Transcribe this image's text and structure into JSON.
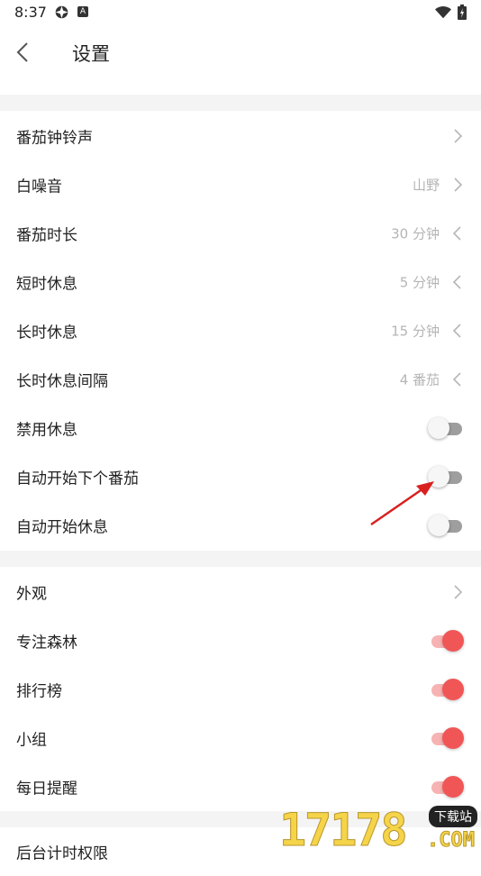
{
  "status": {
    "time": "8:37",
    "icon1": "satellite-icon",
    "icon2": "a-icon",
    "icon3": "wifi-icon",
    "icon4": "battery-icon",
    "badge": "A"
  },
  "header": {
    "title": "设置",
    "back_icon": "chevron-left-icon"
  },
  "settings": [
    {
      "label": "番茄钟铃声",
      "value": ""
    },
    {
      "label": "白噪音",
      "value": "山野"
    },
    {
      "label": "番茄时长",
      "value": "30 分钟"
    },
    {
      "label": "短时休息",
      "value": "5 分钟"
    },
    {
      "label": "长时休息",
      "value": "15 分钟"
    },
    {
      "label": "长时休息间隔",
      "value": "4 番茄"
    },
    {
      "label": "禁用休息",
      "enabled": false
    },
    {
      "label": "自动开始下个番茄",
      "enabled": false
    },
    {
      "label": "自动开始休息",
      "enabled": false
    }
  ],
  "display": [
    {
      "label": "外观"
    },
    {
      "label": "专注森林",
      "enabled": true
    },
    {
      "label": "排行榜",
      "enabled": true
    },
    {
      "label": "小组",
      "enabled": true
    },
    {
      "label": "每日提醒",
      "enabled": true
    }
  ],
  "background": [
    {
      "label": "后台计时权限"
    }
  ],
  "watermark": {
    "text": "17178",
    "badge": "下载站",
    "domain": ".COM"
  },
  "colors": {
    "accent": "#f15656",
    "accent_track": "#f7b3b3",
    "off_track": "#9e9e9e",
    "section_gap": "#f4f4f4",
    "annotation_arrow": "#d9201f"
  }
}
